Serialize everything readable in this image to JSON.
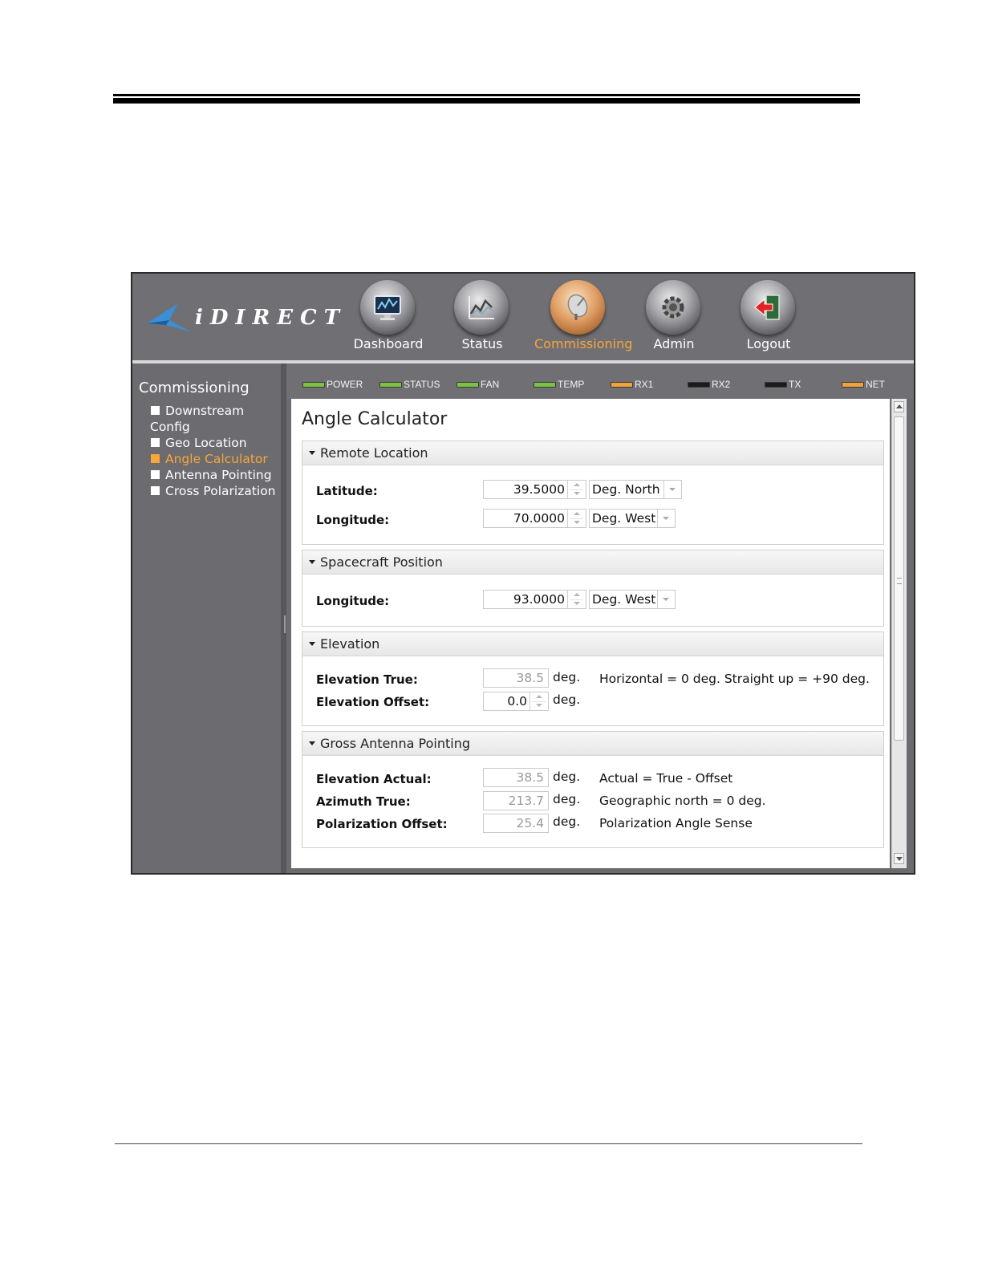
{
  "nav": {
    "logo": "iDIRECT",
    "buttons": [
      {
        "label": "Dashboard",
        "icon": "monitor-icon"
      },
      {
        "label": "Status",
        "icon": "chart-icon"
      },
      {
        "label": "Commissioning",
        "icon": "satellite-dish-icon",
        "active": true
      },
      {
        "label": "Admin",
        "icon": "gear-icon"
      },
      {
        "label": "Logout",
        "icon": "exit-door-icon"
      }
    ]
  },
  "sidebar": {
    "title": "Commissioning",
    "items": [
      {
        "label": "Downstream Config"
      },
      {
        "label": "Geo Location"
      },
      {
        "label": "Angle Calculator",
        "active": true
      },
      {
        "label": "Antenna Pointing"
      },
      {
        "label": "Cross Polarization"
      }
    ]
  },
  "status_leds": [
    {
      "label": "POWER",
      "color": "#7cc243"
    },
    {
      "label": "STATUS",
      "color": "#7cc243"
    },
    {
      "label": "FAN",
      "color": "#7cc243"
    },
    {
      "label": "TEMP",
      "color": "#7cc243"
    },
    {
      "label": "RX1",
      "color": "#f2a23a"
    },
    {
      "label": "RX2",
      "color": "#1a1a1a"
    },
    {
      "label": "TX",
      "color": "#1a1a1a"
    },
    {
      "label": "NET",
      "color": "#f2a23a"
    }
  ],
  "page": {
    "title": "Angle Calculator",
    "remote": {
      "header": "Remote Location",
      "latitude_label": "Latitude:",
      "latitude_value": "39.5000",
      "latitude_dir": "Deg. North",
      "longitude_label": "Longitude:",
      "longitude_value": "70.0000",
      "longitude_dir": "Deg. West"
    },
    "spacecraft": {
      "header": "Spacecraft Position",
      "longitude_label": "Longitude:",
      "longitude_value": "93.0000",
      "longitude_dir": "Deg. West"
    },
    "elevation": {
      "header": "Elevation",
      "true_label": "Elevation True:",
      "true_value": "38.5",
      "true_unit": "deg.",
      "true_note": "Horizontal = 0 deg. Straight up = +90 deg.",
      "offset_label": "Elevation Offset:",
      "offset_value": "0.0",
      "offset_unit": "deg."
    },
    "pointing": {
      "header": "Gross Antenna Pointing",
      "elev_label": "Elevation Actual:",
      "elev_value": "38.5",
      "elev_unit": "deg.",
      "elev_note": "Actual = True - Offset",
      "az_label": "Azimuth True:",
      "az_value": "213.7",
      "az_unit": "deg.",
      "az_note": "Geographic north = 0 deg.",
      "pol_label": "Polarization Offset:",
      "pol_value": "25.4",
      "pol_unit": "deg.",
      "pol_note": "Polarization Angle Sense"
    }
  }
}
